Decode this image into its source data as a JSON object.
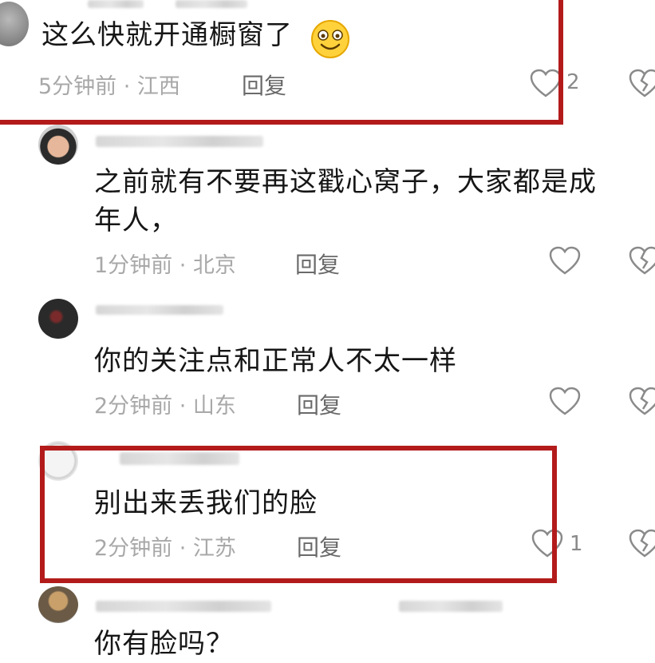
{
  "comments": [
    {
      "text": "这么快就开通橱窗了",
      "meta": "5分钟前 · 江西",
      "reply": "回复",
      "likes": "2",
      "emoji": "smiling-face-emoji"
    },
    {
      "text_line1": "之前就有不要再这戳心窝子，大家都是成",
      "text_line2": "年人，",
      "meta": "1分钟前 · 北京",
      "reply": "回复"
    },
    {
      "text": "你的关注点和正常人不太一样",
      "meta": "2分钟前 · 山东",
      "reply": "回复"
    },
    {
      "text": "别出来丢我们的脸",
      "meta": "2分钟前 · 江苏",
      "reply": "回复",
      "likes": "1"
    },
    {
      "text": "你有脸吗？"
    }
  ],
  "colors": {
    "highlight": "#b31b1b",
    "text": "#161616",
    "meta": "#a8a8a8"
  },
  "icons": [
    "heart-outline-icon",
    "broken-heart-icon"
  ]
}
